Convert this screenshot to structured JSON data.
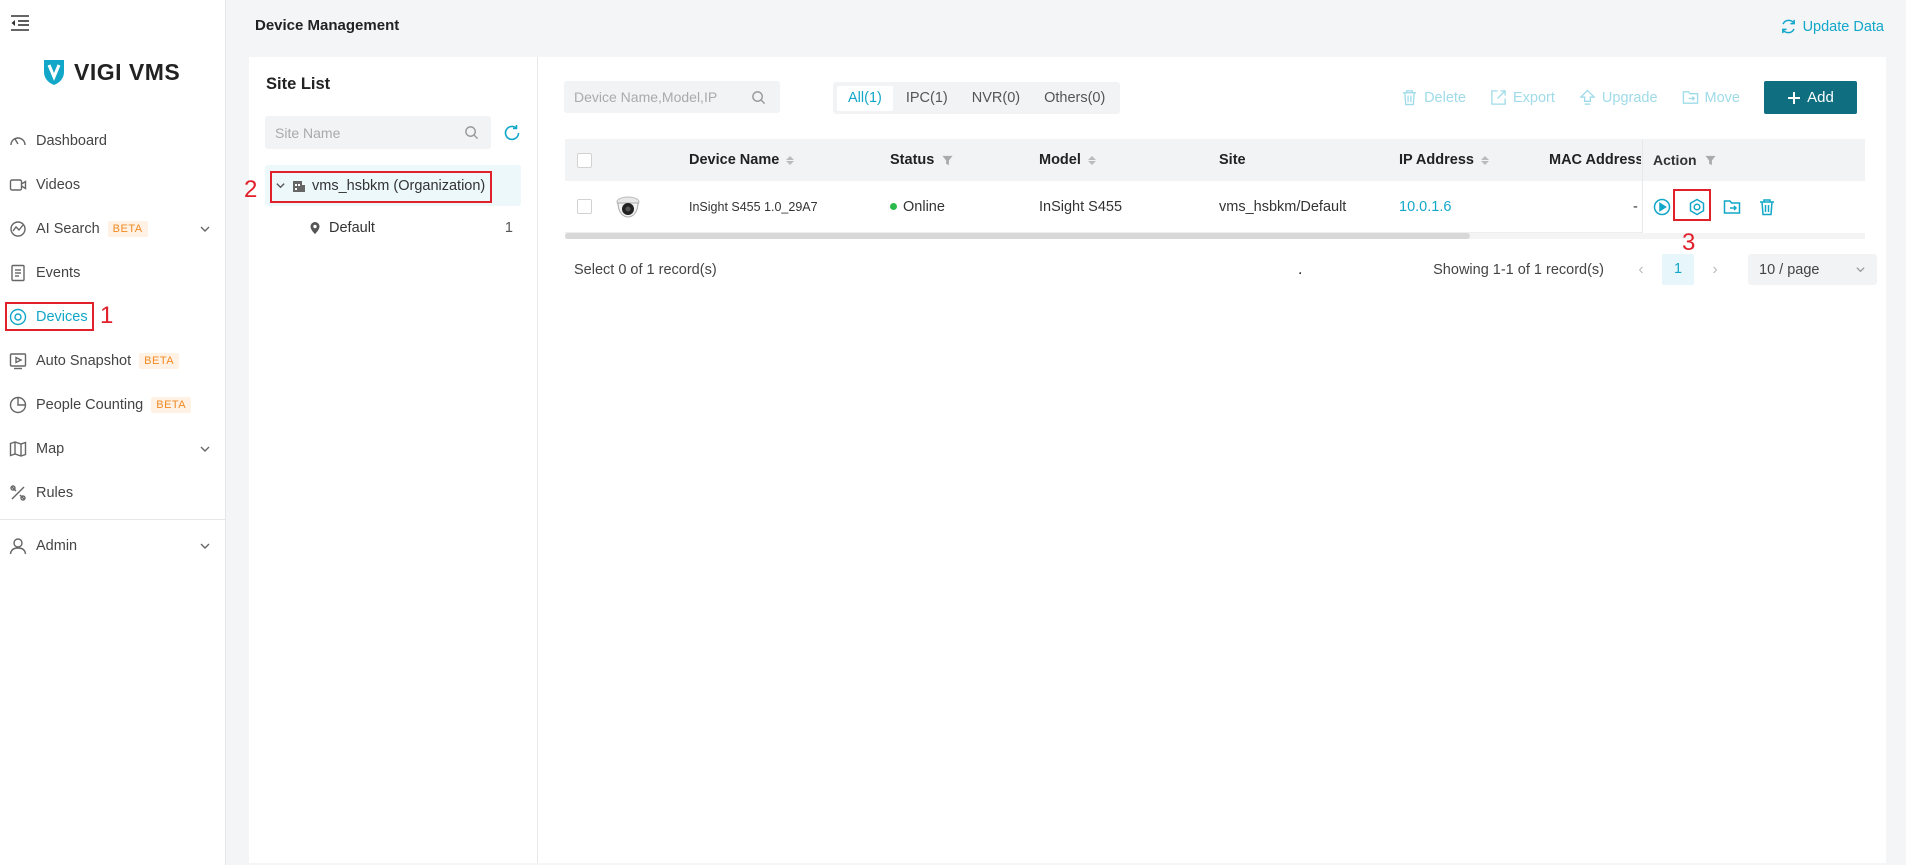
{
  "app": {
    "name": "VIGI VMS",
    "page_title": "Device Management",
    "update_data_label": "Update Data"
  },
  "sidebar": {
    "items": [
      {
        "label": "Dashboard",
        "icon": "dashboard-icon"
      },
      {
        "label": "Videos",
        "icon": "video-icon"
      },
      {
        "label": "AI Search",
        "icon": "ai-search-icon",
        "badge": "BETA",
        "expandable": true
      },
      {
        "label": "Events",
        "icon": "events-icon"
      },
      {
        "label": "Devices",
        "icon": "devices-icon",
        "active": true
      },
      {
        "label": "Auto Snapshot",
        "icon": "snapshot-icon",
        "badge": "BETA"
      },
      {
        "label": "People Counting",
        "icon": "people-counting-icon",
        "badge": "BETA"
      },
      {
        "label": "Map",
        "icon": "map-icon",
        "expandable": true
      },
      {
        "label": "Rules",
        "icon": "rules-icon"
      },
      {
        "label": "Admin",
        "icon": "admin-icon",
        "expandable": true
      }
    ]
  },
  "site_list": {
    "title": "Site List",
    "search_placeholder": "Site Name",
    "organization": "vms_hsbkm (Organization)",
    "sites": [
      {
        "name": "Default",
        "count": "1"
      }
    ]
  },
  "devices": {
    "search_placeholder": "Device Name,Model,IP",
    "tabs": [
      "All(1)",
      "IPC(1)",
      "NVR(0)",
      "Others(0)"
    ],
    "active_tab": 0,
    "toolbar": {
      "delete": "Delete",
      "export": "Export",
      "upgrade": "Upgrade",
      "move": "Move",
      "add": "Add"
    },
    "columns": {
      "device_name": "Device Name",
      "status": "Status",
      "model": "Model",
      "site": "Site",
      "ip": "IP Address",
      "mac": "MAC Address",
      "action": "Action"
    },
    "rows": [
      {
        "device_name": "InSight S455 1.0_29A7",
        "status": "Online",
        "model": "InSight S455",
        "site": "vms_hsbkm/Default",
        "ip": "10.0.1.6",
        "mac": "-"
      }
    ],
    "selection_text": "Select 0 of 1 record(s)",
    "showing_text": "Showing 1-1 of 1 record(s)",
    "current_page": "1",
    "page_size": "10 / page",
    "stray_mark": "."
  },
  "annotations": [
    "1",
    "2",
    "3"
  ],
  "colors": {
    "accent": "#12a7c8",
    "primary_button": "#0f6e80",
    "annotation": "#e0202a",
    "online": "#2ab94b",
    "beta": "#f08a24"
  }
}
